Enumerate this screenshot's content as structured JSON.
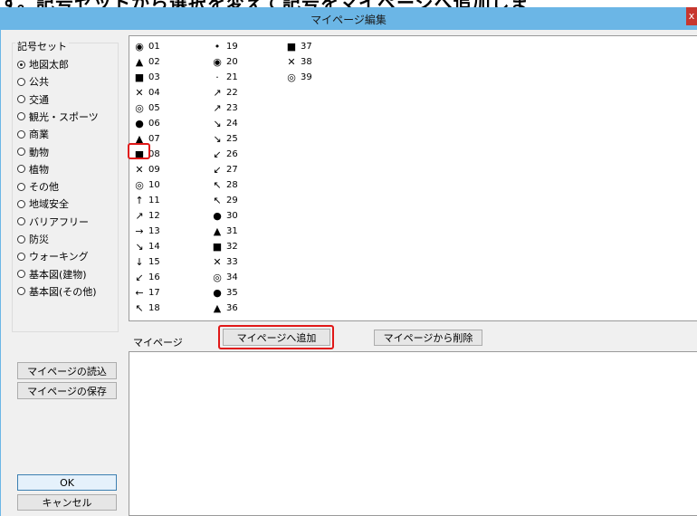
{
  "caption_overlay": "す。記号セットから選択を変えて記号をマイページへ追加しま",
  "window": {
    "title": "マイページ編集",
    "close_label": "x"
  },
  "symbol_set": {
    "legend": "記号セット",
    "selected_index": 0,
    "options": [
      "地図太郎",
      "公共",
      "交通",
      "観光・スポーツ",
      "商業",
      "動物",
      "植物",
      "その他",
      "地域安全",
      "バリアフリー",
      "防災",
      "ウォーキング",
      "基本図(建物)",
      "基本図(その他)"
    ]
  },
  "symbols": {
    "col1": [
      {
        "icon": "small-dot-icon",
        "label": "01"
      },
      {
        "icon": "triangle-icon",
        "label": "02"
      },
      {
        "icon": "square-icon",
        "label": "03"
      },
      {
        "icon": "cross-icon",
        "label": "04"
      },
      {
        "icon": "double-circle-small-icon",
        "label": "05"
      },
      {
        "icon": "filled-circle-icon",
        "label": "06"
      },
      {
        "icon": "large-triangle-icon",
        "label": "07"
      },
      {
        "icon": "large-square-icon",
        "label": "08"
      },
      {
        "icon": "large-cross-icon",
        "label": "09"
      },
      {
        "icon": "large-double-circle-icon",
        "label": "10"
      },
      {
        "icon": "arrow-up-icon",
        "label": "11"
      },
      {
        "icon": "arrow-up-right-icon",
        "label": "12"
      },
      {
        "icon": "arrow-right-icon",
        "label": "13"
      },
      {
        "icon": "arrow-down-right-icon",
        "label": "14"
      },
      {
        "icon": "arrow-down-icon",
        "label": "15"
      },
      {
        "icon": "arrow-down-left-icon",
        "label": "16"
      },
      {
        "icon": "arrow-left-icon",
        "label": "17"
      },
      {
        "icon": "arrow-up-left-icon",
        "label": "18"
      }
    ],
    "col2": [
      {
        "icon": "dot-icon",
        "label": "19"
      },
      {
        "icon": "small-dot-icon",
        "label": "20"
      },
      {
        "icon": "tiny-dot-icon",
        "label": "21"
      },
      {
        "icon": "arrow-up-right-icon",
        "label": "22"
      },
      {
        "icon": "arrow-right-up-icon",
        "label": "23"
      },
      {
        "icon": "arrow-right-down-icon",
        "label": "24"
      },
      {
        "icon": "arrow-down-right-icon",
        "label": "25"
      },
      {
        "icon": "arrow-down-left-icon",
        "label": "26"
      },
      {
        "icon": "arrow-left-down-icon",
        "label": "27"
      },
      {
        "icon": "arrow-left-up-icon",
        "label": "28"
      },
      {
        "icon": "arrow-up-left-icon",
        "label": "29"
      },
      {
        "icon": "filled-circle-icon",
        "label": "30"
      },
      {
        "icon": "triangle-icon",
        "label": "31"
      },
      {
        "icon": "square-icon",
        "label": "32"
      },
      {
        "icon": "cross-icon",
        "label": "33"
      },
      {
        "icon": "double-circle-icon",
        "label": "34"
      },
      {
        "icon": "filled-circle-icon",
        "label": "35"
      },
      {
        "icon": "triangle-icon",
        "label": "36"
      }
    ],
    "col3": [
      {
        "icon": "square-icon",
        "label": "37"
      },
      {
        "icon": "large-cross-icon",
        "label": "38"
      },
      {
        "icon": "double-circle-icon",
        "label": "39"
      }
    ]
  },
  "glyphs": {
    "small-dot-icon": "◉",
    "triangle-icon": "▲",
    "square-icon": "■",
    "cross-icon": "✕",
    "double-circle-small-icon": "◎",
    "filled-circle-icon": "●",
    "large-triangle-icon": "▲",
    "large-square-icon": "■",
    "large-cross-icon": "✕",
    "large-double-circle-icon": "◎",
    "arrow-up-icon": "↑",
    "arrow-up-right-icon": "↗",
    "arrow-right-icon": "→",
    "arrow-down-right-icon": "↘",
    "arrow-down-icon": "↓",
    "arrow-down-left-icon": "↙",
    "arrow-left-icon": "←",
    "arrow-up-left-icon": "↖",
    "dot-icon": "•",
    "tiny-dot-icon": "·",
    "arrow-right-up-icon": "↗",
    "arrow-right-down-icon": "↘",
    "arrow-left-down-icon": "↙",
    "arrow-left-up-icon": "↖",
    "double-circle-icon": "◎"
  },
  "mypage": {
    "label": "マイページ",
    "add_button": "マイページへ追加",
    "remove_button": "マイページから削除",
    "load_button": "マイページの読込",
    "save_button": "マイページの保存"
  },
  "dialog_buttons": {
    "ok": "OK",
    "cancel": "キャンセル"
  },
  "colors": {
    "highlight": "#e01818",
    "titlebar": "#6bb6e6"
  }
}
